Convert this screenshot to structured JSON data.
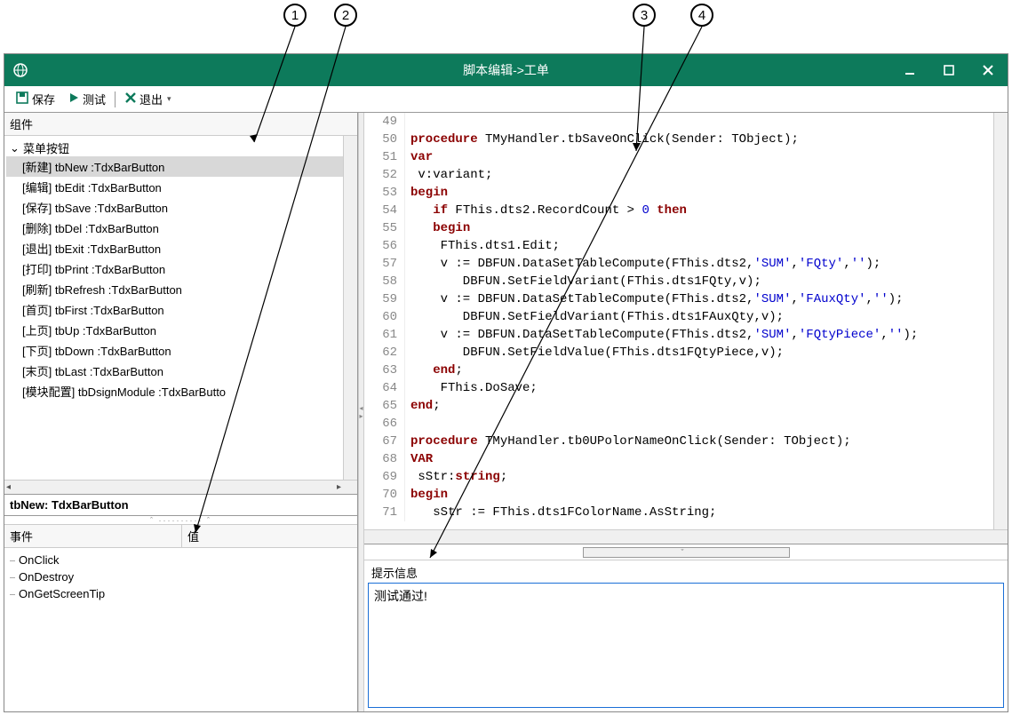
{
  "annotations": {
    "a1": "1",
    "a2": "2",
    "a3": "3",
    "a4": "4"
  },
  "titlebar": {
    "title": "脚本编辑->工单"
  },
  "toolbar": {
    "save": "保存",
    "test": "测试",
    "exit": "退出"
  },
  "leftPanel": {
    "componentsLabel": "组件",
    "treeRoot": "菜单按钮",
    "items": [
      "[新建] tbNew :TdxBarButton",
      "[编辑] tbEdit :TdxBarButton",
      "[保存] tbSave :TdxBarButton",
      "[删除] tbDel :TdxBarButton",
      "[退出] tbExit :TdxBarButton",
      "[打印] tbPrint :TdxBarButton",
      "[刷新] tbRefresh :TdxBarButton",
      "[首页] tbFirst :TdxBarButton",
      "[上页] tbUp :TdxBarButton",
      "[下页] tbDown :TdxBarButton",
      "[末页] tbLast :TdxBarButton",
      "[模块配置] tbDsignModule :TdxBarButto"
    ],
    "selectedLabel": "tbNew:    TdxBarButton",
    "eventsHeader": {
      "c1": "事件",
      "c2": "值"
    },
    "events": [
      "OnClick",
      "OnDestroy",
      "OnGetScreenTip"
    ]
  },
  "code": {
    "lines": [
      {
        "n": 49,
        "t": [
          {
            "c": "",
            "cls": ""
          }
        ]
      },
      {
        "n": 50,
        "t": [
          {
            "c": "procedure",
            "cls": "kwred"
          },
          {
            "c": " TMyHandler.tbSaveOnClick(Sender: TObject);",
            "cls": "ident"
          }
        ]
      },
      {
        "n": 51,
        "t": [
          {
            "c": "var",
            "cls": "kwred"
          }
        ]
      },
      {
        "n": 52,
        "t": [
          {
            "c": " v:variant;",
            "cls": "ident"
          }
        ]
      },
      {
        "n": 53,
        "t": [
          {
            "c": "begin",
            "cls": "kwred"
          }
        ]
      },
      {
        "n": 54,
        "t": [
          {
            "c": "   ",
            "cls": ""
          },
          {
            "c": "if",
            "cls": "kwred"
          },
          {
            "c": " FThis.dts2.RecordCount > ",
            "cls": "ident"
          },
          {
            "c": "0",
            "cls": "num"
          },
          {
            "c": " ",
            "cls": ""
          },
          {
            "c": "then",
            "cls": "kwred"
          }
        ]
      },
      {
        "n": 55,
        "t": [
          {
            "c": "   ",
            "cls": ""
          },
          {
            "c": "begin",
            "cls": "kwred"
          }
        ]
      },
      {
        "n": 56,
        "t": [
          {
            "c": "    FThis.dts1.Edit;",
            "cls": "ident"
          }
        ]
      },
      {
        "n": 57,
        "t": [
          {
            "c": "    v := DBFUN.DataSetTableCompute(FThis.dts2,",
            "cls": "ident"
          },
          {
            "c": "'SUM'",
            "cls": "str"
          },
          {
            "c": ",",
            "cls": "ident"
          },
          {
            "c": "'FQty'",
            "cls": "str"
          },
          {
            "c": ",",
            "cls": "ident"
          },
          {
            "c": "''",
            "cls": "str"
          },
          {
            "c": ");",
            "cls": "ident"
          }
        ]
      },
      {
        "n": 58,
        "t": [
          {
            "c": "       DBFUN.SetFieldVariant(FThis.dts1FQty,v);",
            "cls": "ident"
          }
        ]
      },
      {
        "n": 59,
        "t": [
          {
            "c": "    v := DBFUN.DataSetTableCompute(FThis.dts2,",
            "cls": "ident"
          },
          {
            "c": "'SUM'",
            "cls": "str"
          },
          {
            "c": ",",
            "cls": "ident"
          },
          {
            "c": "'FAuxQty'",
            "cls": "str"
          },
          {
            "c": ",",
            "cls": "ident"
          },
          {
            "c": "''",
            "cls": "str"
          },
          {
            "c": ");",
            "cls": "ident"
          }
        ]
      },
      {
        "n": 60,
        "t": [
          {
            "c": "       DBFUN.SetFieldVariant(FThis.dts1FAuxQty,v);",
            "cls": "ident"
          }
        ]
      },
      {
        "n": 61,
        "t": [
          {
            "c": "    v := DBFUN.DataSetTableCompute(FThis.dts2,",
            "cls": "ident"
          },
          {
            "c": "'SUM'",
            "cls": "str"
          },
          {
            "c": ",",
            "cls": "ident"
          },
          {
            "c": "'FQtyPiece'",
            "cls": "str"
          },
          {
            "c": ",",
            "cls": "ident"
          },
          {
            "c": "''",
            "cls": "str"
          },
          {
            "c": ");",
            "cls": "ident"
          }
        ]
      },
      {
        "n": 62,
        "t": [
          {
            "c": "       DBFUN.SetFieldValue(FThis.dts1FQtyPiece,v);",
            "cls": "ident"
          }
        ]
      },
      {
        "n": 63,
        "t": [
          {
            "c": "   ",
            "cls": ""
          },
          {
            "c": "end",
            "cls": "kwred"
          },
          {
            "c": ";",
            "cls": "ident"
          }
        ]
      },
      {
        "n": 64,
        "t": [
          {
            "c": "    FThis.DoSave;",
            "cls": "ident"
          }
        ]
      },
      {
        "n": 65,
        "t": [
          {
            "c": "end",
            "cls": "kwred"
          },
          {
            "c": ";",
            "cls": "ident"
          }
        ]
      },
      {
        "n": 66,
        "t": [
          {
            "c": "",
            "cls": ""
          }
        ]
      },
      {
        "n": 67,
        "t": [
          {
            "c": "procedure",
            "cls": "kwred"
          },
          {
            "c": " TMyHandler.tb0UPolorNameOnClick(Sender: TObject);",
            "cls": "ident"
          }
        ]
      },
      {
        "n": 68,
        "t": [
          {
            "c": "VAR",
            "cls": "kwred"
          }
        ]
      },
      {
        "n": 69,
        "t": [
          {
            "c": " sStr:",
            "cls": "ident"
          },
          {
            "c": "string",
            "cls": "kwred"
          },
          {
            "c": ";",
            "cls": "ident"
          }
        ]
      },
      {
        "n": 70,
        "t": [
          {
            "c": "begin",
            "cls": "kwred"
          }
        ]
      },
      {
        "n": 71,
        "t": [
          {
            "c": "   sStr := FThis.dts1FColorName.AsString;",
            "cls": "ident"
          }
        ]
      }
    ]
  },
  "hint": {
    "label": "提示信息",
    "text": "测试通过!"
  }
}
